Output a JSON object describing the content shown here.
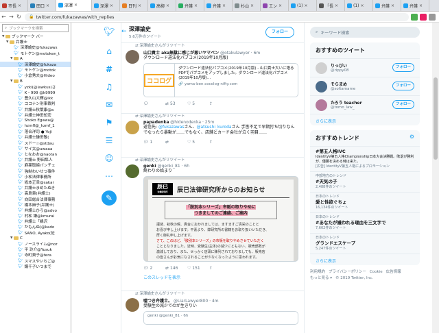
{
  "browser": {
    "tabs": [
      {
        "label": "市長",
        "color": "#c0392b",
        "active": false
      },
      {
        "label": "田口",
        "color": "#2980b9",
        "active": false
      },
      {
        "label": "深澤",
        "color": "#1da1f2",
        "active": true
      },
      {
        "label": "深澤",
        "color": "#1da1f2",
        "active": false
      },
      {
        "label": "日刊",
        "color": "#e67e22",
        "active": false
      },
      {
        "label": "高柳",
        "color": "#1da1f2",
        "active": false
      },
      {
        "label": "弁護",
        "color": "#27ae60",
        "active": false
      },
      {
        "label": "弁護",
        "color": "#1da1f2",
        "active": false
      },
      {
        "label": "杉山",
        "color": "#7f8c8d",
        "active": false
      },
      {
        "label": "エン",
        "color": "#8e44ad",
        "active": false
      },
      {
        "label": "(1) ",
        "color": "#1da1f2",
        "active": false
      },
      {
        "label": "「長",
        "color": "#555555",
        "active": false
      },
      {
        "label": "(1) ",
        "color": "#1da1f2",
        "active": false
      },
      {
        "label": "弁護",
        "color": "#1da1f2",
        "active": false
      },
      {
        "label": "弁護",
        "color": "#1da1f2",
        "active": false
      }
    ],
    "url": "twitter.com/fukazawas/with_replies"
  },
  "sidebar": {
    "search_placeholder": "ブックマークを検索",
    "rows": [
      {
        "type": "folder",
        "label": "ブックマーク バー",
        "indent": 0,
        "open": true
      },
      {
        "type": "folder",
        "label": "弁護士",
        "indent": 1,
        "open": true
      },
      {
        "type": "link",
        "label": "深澤諭史@fukazaws",
        "indent": 2
      },
      {
        "type": "link",
        "label": "モトケン@motoken_t",
        "indent": 2
      },
      {
        "type": "folder",
        "label": "A",
        "indent": 2,
        "open": true
      },
      {
        "type": "link",
        "label": "深澤諭史@fukaza",
        "indent": 3,
        "selected": true
      },
      {
        "type": "link",
        "label": "モトケン@motok",
        "indent": 3
      },
      {
        "type": "link",
        "label": "小倉秀夫@Hideo",
        "indent": 3
      },
      {
        "type": "folder",
        "label": "B",
        "indent": 2,
        "open": true
      },
      {
        "type": "link",
        "label": "yzki(@lawkus)さ",
        "indent": 3
      },
      {
        "type": "link",
        "label": "K・999 @k9999",
        "indent": 3
      },
      {
        "type": "link",
        "label": "豊久山大輝@ikk",
        "indent": 3
      },
      {
        "type": "link",
        "label": "ココナン刑事裁判",
        "indent": 3
      },
      {
        "type": "link",
        "label": "弁護士秋葉康@a",
        "indent": 3
      },
      {
        "type": "link",
        "label": "弁護士神田知宏",
        "indent": 3
      },
      {
        "type": "link",
        "label": "Shoko Egawa@",
        "indent": 3
      },
      {
        "type": "link",
        "label": "hzmfl@_hzmf_1",
        "indent": 3
      },
      {
        "type": "link",
        "label": "落合洋司 ● Yoji",
        "indent": 3
      },
      {
        "type": "link",
        "label": "弁護士鎌田敬(",
        "indent": 3
      },
      {
        "type": "link",
        "label": "スドー☆@stdau",
        "indent": 3
      },
      {
        "type": "link",
        "label": "サイ太@uwaaa",
        "indent": 3
      },
      {
        "type": "link",
        "label": "となおお@naotan",
        "indent": 3
      },
      {
        "type": "link",
        "label": "弁護士 野田隼人",
        "indent": 3
      },
      {
        "type": "link",
        "label": "麻薬取締パンチェ",
        "indent": 3
      },
      {
        "type": "link",
        "label": "強制わいせつ事件",
        "indent": 3
      },
      {
        "type": "link",
        "label": "小松法律事務所",
        "indent": 3
      },
      {
        "type": "link",
        "label": "坂本正幸@sakar",
        "indent": 3
      },
      {
        "type": "link",
        "label": "弁護士まめたぬき",
        "indent": 3
      },
      {
        "type": "link",
        "label": "高島章(弁護士)",
        "indent": 3
      },
      {
        "type": "link",
        "label": "向田総合法律事務",
        "indent": 3
      },
      {
        "type": "link",
        "label": "橋本麻子(弁護士)",
        "indent": 3
      },
      {
        "type": "link",
        "label": "弁護士ひろ@advo",
        "indent": 3
      },
      {
        "type": "link",
        "label": "村松 謙@kmurai",
        "indent": 3
      },
      {
        "type": "link",
        "label": "弁護士「鵜沢",
        "indent": 3
      },
      {
        "type": "link",
        "label": "かもんぬ(@kado",
        "indent": 3
      },
      {
        "type": "link",
        "label": "SANO, Ayako(佐",
        "indent": 3
      },
      {
        "type": "folder",
        "label": "C",
        "indent": 2,
        "open": true
      },
      {
        "type": "link",
        "label": "ノースライム@nor",
        "indent": 3
      },
      {
        "type": "link",
        "label": "平 玲介@Yusuk",
        "indent": 3
      },
      {
        "type": "link",
        "label": "寺町東子@tera",
        "indent": 3
      },
      {
        "type": "link",
        "label": "スマスやいちご@",
        "indent": 3
      },
      {
        "type": "link",
        "label": "鋼千子いつまで",
        "indent": 3
      }
    ]
  },
  "profile": {
    "name": "深澤諭史",
    "tweet_count": "5.6万件のツイート",
    "follow_label": "フォロー"
  },
  "tweets": [
    {
      "rt_label": "深澤諭史さんがリツイート",
      "name": "山口貴士 aka無駄に感じが悪いヤマベン",
      "handle": "@otakulawyer · 6m",
      "text": "ダウンロード違法化パブコメ(2019年10月版)",
      "avatar_color": "#7a6a5a",
      "card": {
        "logo": "ココログ",
        "title": "ダウンロード違法化パブコメ(2019年10月版) - 山口貴士大いに語る",
        "desc": "PDFでパブコメをアップしました。ダウンロード違法化パブコメ(2019年10月版)...",
        "url": "yama-ben.cocolog-nifty.com"
      },
      "replies": "",
      "retweets": "53",
      "likes": "5"
    },
    {
      "rt_label": "深澤諭史さんがリツイート",
      "name": "papadenka",
      "handle": "@hidenodenka · 25m",
      "text_pre": "返信先: ",
      "mentions": "@fukazawas",
      "text_mid": "さん、",
      "mentions2": "@atsushi_kuroda",
      "text_post": "さん 手筈不足で早期打ち切りなんでなったら暴動が……でもなく、店舗とカード会社が泣く羽目……",
      "avatar_color": "#c9a24a",
      "replies": "1",
      "retweets": "",
      "likes": "5"
    },
    {
      "rt_label": "深澤諭史さんがリツイート",
      "name": "genki",
      "handle": "@genki_81 · 6h",
      "text": "終わりの始まり",
      "avatar_color": "#556b2f",
      "notice": {
        "logo": "辰已",
        "logo_sub": "法律研究所",
        "title": "辰已法律研究所からのお知らせ",
        "box_line1": "「肢別本シリーズ」市販の取りやめに",
        "box_line2": "つきましてのご連絡、ご案内",
        "body_1": "謹啓、初秋の候、貴台におかれましては、ますますご清栄のことと",
        "body_2": "お喜び申し上げます。平素より、弊研究所の書籍をお取り扱いいただき、",
        "body_3": "厚く御礼申し上げます。",
        "body_red": "さて、このほど、「肢別本シリーズ」の市販を取りやめさせていただく",
        "body_4": "こととなりました。近時、受験生(主体)の減少にともない、販売部数が",
        "body_5": "激減しており、また、せっかく店頭に陳列されておりましても、販売店",
        "body_6": "の皆さんがお気になされることが少なくなったように思われます。"
      },
      "replies": "2",
      "retweets": "146",
      "likes": "151",
      "show_thread": "このスレッドを表示"
    },
    {
      "rt_label": "深澤諭史さんがリツイート",
      "name": "嘘つき弁護士。",
      "handle": "@LiarLawyer800 · 4m",
      "text": "受験生の減少でのが生きりい",
      "avatar_color": "#8b6f47",
      "quote_head": "genki @genki_81 · 6h"
    }
  ],
  "right": {
    "search_placeholder": "キーワード検索",
    "who_title": "おすすめのツイート",
    "who": [
      {
        "name": "りっぴい",
        "handle": "@rippy08",
        "color": "#d0d0d0"
      },
      {
        "name": "そらまめ",
        "handle": "@soltamame",
        "color": "#4a6b8a"
      },
      {
        "name": "たろう teacher",
        "handle": "@tomo_law_",
        "color": "#b47a9c"
      }
    ],
    "follow_label": "フォロー",
    "more_label": "さらに表示",
    "trends_title": "おすすめトレンド",
    "trends": [
      {
        "ctx": "",
        "title": "#第五人格IVC",
        "desc": "IdentityV第五人格Championship日本大会決勝戦。敗退が勝利が、優勝を決める時は来た。",
        "promo": "[広告] IdentityV第五人格によるプロモーション",
        "count": ""
      },
      {
        "ctx": "中部地方のトレンド",
        "title": "#天気の子",
        "desc": "",
        "promo": "",
        "count": "2,488件のツイート"
      },
      {
        "ctx": "日本のトレンド",
        "title": "愛と性欲ぐちょ",
        "desc": "",
        "promo": "",
        "count": "16,134件のツイート"
      },
      {
        "ctx": "日本のトレンド",
        "title": "#あなたが嫌われる理由を三文字で",
        "desc": "",
        "promo": "",
        "count": "7,602件のツイート"
      },
      {
        "ctx": "日本のトレンド",
        "title": "グランドエスケープ",
        "desc": "",
        "promo": "",
        "count": "5,247件のツイート"
      }
    ],
    "trends_more": "さらに表示",
    "footer_links": [
      "利用規約",
      "プライバシーポリシー",
      "Cookie",
      "広告情報"
    ],
    "footer_more": "もっと見る ▾",
    "footer_copy": "© 2019 Twitter, Inc."
  }
}
